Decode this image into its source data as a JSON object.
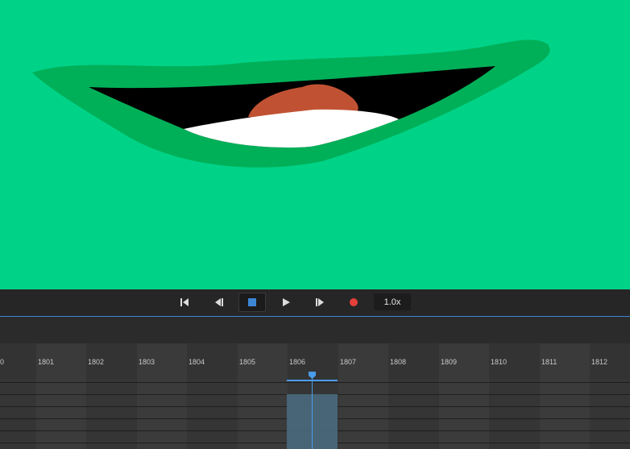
{
  "canvas": {
    "background": "#00d388",
    "lip_color": "#00b058",
    "mouth_color": "#000000",
    "tongue_color": "#c05233",
    "teeth_color": "#ffffff"
  },
  "transport": {
    "icons": [
      "skip-to-start-icon",
      "step-back-icon",
      "stop-icon",
      "play-icon",
      "step-forward-icon",
      "record-icon"
    ],
    "speed_label": "1.0x",
    "record_color": "#e5403a",
    "stop_color": "#3d86d6"
  },
  "timeline": {
    "frames": [
      "0",
      "1801",
      "1802",
      "1803",
      "1804",
      "1805",
      "1806",
      "1807",
      "1808",
      "1809",
      "1810",
      "1811",
      "1812"
    ],
    "current_frame": "1806",
    "accent_color": "#4a9bea"
  }
}
